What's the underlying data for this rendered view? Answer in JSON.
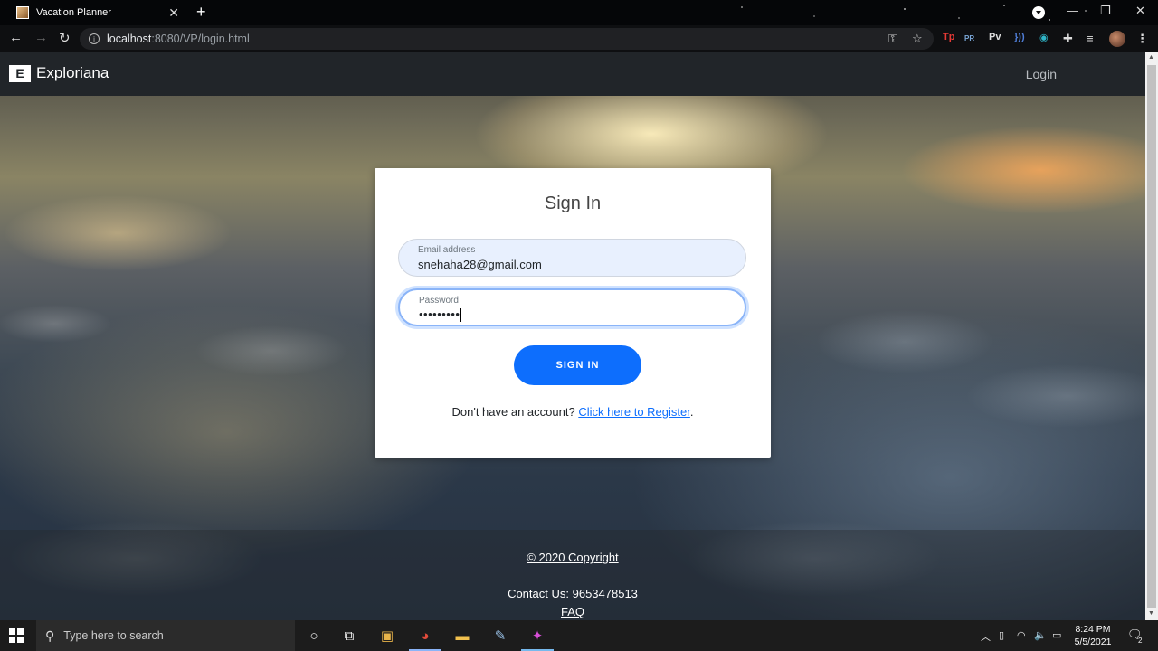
{
  "browser": {
    "tab_title": "Vacation Planner",
    "url_host": "localhost",
    "url_rest": ":8080/VP/login.html"
  },
  "site": {
    "brand_logo": "E",
    "brand_name": "Exploriana",
    "nav_login": "Login"
  },
  "login_form": {
    "title": "Sign In",
    "email_label": "Email address",
    "email_value": "snehaha28@gmail.com",
    "password_label": "Password",
    "password_value": "•••••••••",
    "signin_button": "SIGN IN",
    "register_prompt": "Don't have an account?",
    "register_link": "Click here to Register",
    "register_suffix": "."
  },
  "footer": {
    "copyright": "© 2020 Copyright",
    "contact_label": "Contact Us:",
    "contact_phone": "9653478513",
    "faq": "FAQ"
  },
  "taskbar": {
    "search_placeholder": "Type here to search",
    "time": "8:24 PM",
    "date": "5/5/2021",
    "notification_count": "2"
  }
}
